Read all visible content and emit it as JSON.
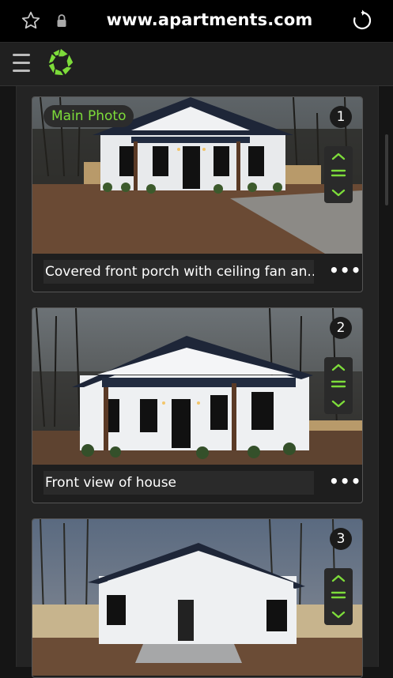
{
  "browser": {
    "url": "www.apartments.com"
  },
  "app": {
    "menu_icon": "hamburger-icon",
    "logo_icon": "apartments-logo-icon"
  },
  "photos": [
    {
      "index": "1",
      "badge": "Main Photo",
      "caption": "Covered front porch with ceiling fan an...",
      "more": "•••"
    },
    {
      "index": "2",
      "caption": "Front view of house",
      "more": "•••"
    },
    {
      "index": "3"
    }
  ],
  "colors": {
    "accent": "#7ddc3a",
    "background": "#151515",
    "card": "#1e1e1e"
  }
}
